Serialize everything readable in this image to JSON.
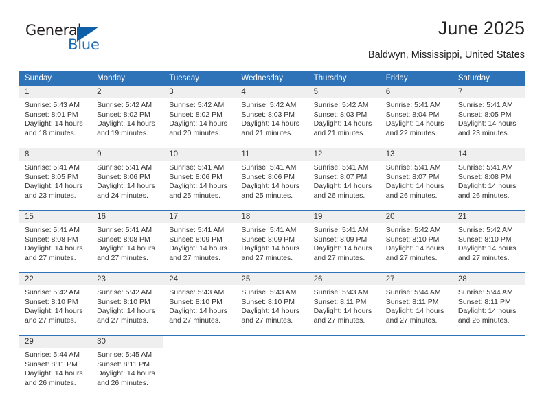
{
  "logo": {
    "word_one": "General",
    "word_two": "Blue",
    "triangle_icon": "blue-triangle-icon",
    "brand_blue": "#1c6cb5"
  },
  "header": {
    "title": "June 2025",
    "subtitle": "Baldwyn, Mississippi, United States"
  },
  "calendar": {
    "header_bg": "#2e72b8",
    "day_header_bg": "#efefef",
    "weekdays": [
      "Sunday",
      "Monday",
      "Tuesday",
      "Wednesday",
      "Thursday",
      "Friday",
      "Saturday"
    ],
    "weeks": [
      [
        {
          "day": "1",
          "sunrise": "Sunrise: 5:43 AM",
          "sunset": "Sunset: 8:01 PM",
          "daylight_line1": "Daylight: 14 hours",
          "daylight_line2": "and 18 minutes."
        },
        {
          "day": "2",
          "sunrise": "Sunrise: 5:42 AM",
          "sunset": "Sunset: 8:02 PM",
          "daylight_line1": "Daylight: 14 hours",
          "daylight_line2": "and 19 minutes."
        },
        {
          "day": "3",
          "sunrise": "Sunrise: 5:42 AM",
          "sunset": "Sunset: 8:02 PM",
          "daylight_line1": "Daylight: 14 hours",
          "daylight_line2": "and 20 minutes."
        },
        {
          "day": "4",
          "sunrise": "Sunrise: 5:42 AM",
          "sunset": "Sunset: 8:03 PM",
          "daylight_line1": "Daylight: 14 hours",
          "daylight_line2": "and 21 minutes."
        },
        {
          "day": "5",
          "sunrise": "Sunrise: 5:42 AM",
          "sunset": "Sunset: 8:03 PM",
          "daylight_line1": "Daylight: 14 hours",
          "daylight_line2": "and 21 minutes."
        },
        {
          "day": "6",
          "sunrise": "Sunrise: 5:41 AM",
          "sunset": "Sunset: 8:04 PM",
          "daylight_line1": "Daylight: 14 hours",
          "daylight_line2": "and 22 minutes."
        },
        {
          "day": "7",
          "sunrise": "Sunrise: 5:41 AM",
          "sunset": "Sunset: 8:05 PM",
          "daylight_line1": "Daylight: 14 hours",
          "daylight_line2": "and 23 minutes."
        }
      ],
      [
        {
          "day": "8",
          "sunrise": "Sunrise: 5:41 AM",
          "sunset": "Sunset: 8:05 PM",
          "daylight_line1": "Daylight: 14 hours",
          "daylight_line2": "and 23 minutes."
        },
        {
          "day": "9",
          "sunrise": "Sunrise: 5:41 AM",
          "sunset": "Sunset: 8:06 PM",
          "daylight_line1": "Daylight: 14 hours",
          "daylight_line2": "and 24 minutes."
        },
        {
          "day": "10",
          "sunrise": "Sunrise: 5:41 AM",
          "sunset": "Sunset: 8:06 PM",
          "daylight_line1": "Daylight: 14 hours",
          "daylight_line2": "and 25 minutes."
        },
        {
          "day": "11",
          "sunrise": "Sunrise: 5:41 AM",
          "sunset": "Sunset: 8:06 PM",
          "daylight_line1": "Daylight: 14 hours",
          "daylight_line2": "and 25 minutes."
        },
        {
          "day": "12",
          "sunrise": "Sunrise: 5:41 AM",
          "sunset": "Sunset: 8:07 PM",
          "daylight_line1": "Daylight: 14 hours",
          "daylight_line2": "and 26 minutes."
        },
        {
          "day": "13",
          "sunrise": "Sunrise: 5:41 AM",
          "sunset": "Sunset: 8:07 PM",
          "daylight_line1": "Daylight: 14 hours",
          "daylight_line2": "and 26 minutes."
        },
        {
          "day": "14",
          "sunrise": "Sunrise: 5:41 AM",
          "sunset": "Sunset: 8:08 PM",
          "daylight_line1": "Daylight: 14 hours",
          "daylight_line2": "and 26 minutes."
        }
      ],
      [
        {
          "day": "15",
          "sunrise": "Sunrise: 5:41 AM",
          "sunset": "Sunset: 8:08 PM",
          "daylight_line1": "Daylight: 14 hours",
          "daylight_line2": "and 27 minutes."
        },
        {
          "day": "16",
          "sunrise": "Sunrise: 5:41 AM",
          "sunset": "Sunset: 8:08 PM",
          "daylight_line1": "Daylight: 14 hours",
          "daylight_line2": "and 27 minutes."
        },
        {
          "day": "17",
          "sunrise": "Sunrise: 5:41 AM",
          "sunset": "Sunset: 8:09 PM",
          "daylight_line1": "Daylight: 14 hours",
          "daylight_line2": "and 27 minutes."
        },
        {
          "day": "18",
          "sunrise": "Sunrise: 5:41 AM",
          "sunset": "Sunset: 8:09 PM",
          "daylight_line1": "Daylight: 14 hours",
          "daylight_line2": "and 27 minutes."
        },
        {
          "day": "19",
          "sunrise": "Sunrise: 5:41 AM",
          "sunset": "Sunset: 8:09 PM",
          "daylight_line1": "Daylight: 14 hours",
          "daylight_line2": "and 27 minutes."
        },
        {
          "day": "20",
          "sunrise": "Sunrise: 5:42 AM",
          "sunset": "Sunset: 8:10 PM",
          "daylight_line1": "Daylight: 14 hours",
          "daylight_line2": "and 27 minutes."
        },
        {
          "day": "21",
          "sunrise": "Sunrise: 5:42 AM",
          "sunset": "Sunset: 8:10 PM",
          "daylight_line1": "Daylight: 14 hours",
          "daylight_line2": "and 27 minutes."
        }
      ],
      [
        {
          "day": "22",
          "sunrise": "Sunrise: 5:42 AM",
          "sunset": "Sunset: 8:10 PM",
          "daylight_line1": "Daylight: 14 hours",
          "daylight_line2": "and 27 minutes."
        },
        {
          "day": "23",
          "sunrise": "Sunrise: 5:42 AM",
          "sunset": "Sunset: 8:10 PM",
          "daylight_line1": "Daylight: 14 hours",
          "daylight_line2": "and 27 minutes."
        },
        {
          "day": "24",
          "sunrise": "Sunrise: 5:43 AM",
          "sunset": "Sunset: 8:10 PM",
          "daylight_line1": "Daylight: 14 hours",
          "daylight_line2": "and 27 minutes."
        },
        {
          "day": "25",
          "sunrise": "Sunrise: 5:43 AM",
          "sunset": "Sunset: 8:10 PM",
          "daylight_line1": "Daylight: 14 hours",
          "daylight_line2": "and 27 minutes."
        },
        {
          "day": "26",
          "sunrise": "Sunrise: 5:43 AM",
          "sunset": "Sunset: 8:11 PM",
          "daylight_line1": "Daylight: 14 hours",
          "daylight_line2": "and 27 minutes."
        },
        {
          "day": "27",
          "sunrise": "Sunrise: 5:44 AM",
          "sunset": "Sunset: 8:11 PM",
          "daylight_line1": "Daylight: 14 hours",
          "daylight_line2": "and 27 minutes."
        },
        {
          "day": "28",
          "sunrise": "Sunrise: 5:44 AM",
          "sunset": "Sunset: 8:11 PM",
          "daylight_line1": "Daylight: 14 hours",
          "daylight_line2": "and 26 minutes."
        }
      ],
      [
        {
          "day": "29",
          "sunrise": "Sunrise: 5:44 AM",
          "sunset": "Sunset: 8:11 PM",
          "daylight_line1": "Daylight: 14 hours",
          "daylight_line2": "and 26 minutes."
        },
        {
          "day": "30",
          "sunrise": "Sunrise: 5:45 AM",
          "sunset": "Sunset: 8:11 PM",
          "daylight_line1": "Daylight: 14 hours",
          "daylight_line2": "and 26 minutes."
        },
        {
          "day": "",
          "sunrise": "",
          "sunset": "",
          "daylight_line1": "",
          "daylight_line2": ""
        },
        {
          "day": "",
          "sunrise": "",
          "sunset": "",
          "daylight_line1": "",
          "daylight_line2": ""
        },
        {
          "day": "",
          "sunrise": "",
          "sunset": "",
          "daylight_line1": "",
          "daylight_line2": ""
        },
        {
          "day": "",
          "sunrise": "",
          "sunset": "",
          "daylight_line1": "",
          "daylight_line2": ""
        },
        {
          "day": "",
          "sunrise": "",
          "sunset": "",
          "daylight_line1": "",
          "daylight_line2": ""
        }
      ]
    ]
  }
}
